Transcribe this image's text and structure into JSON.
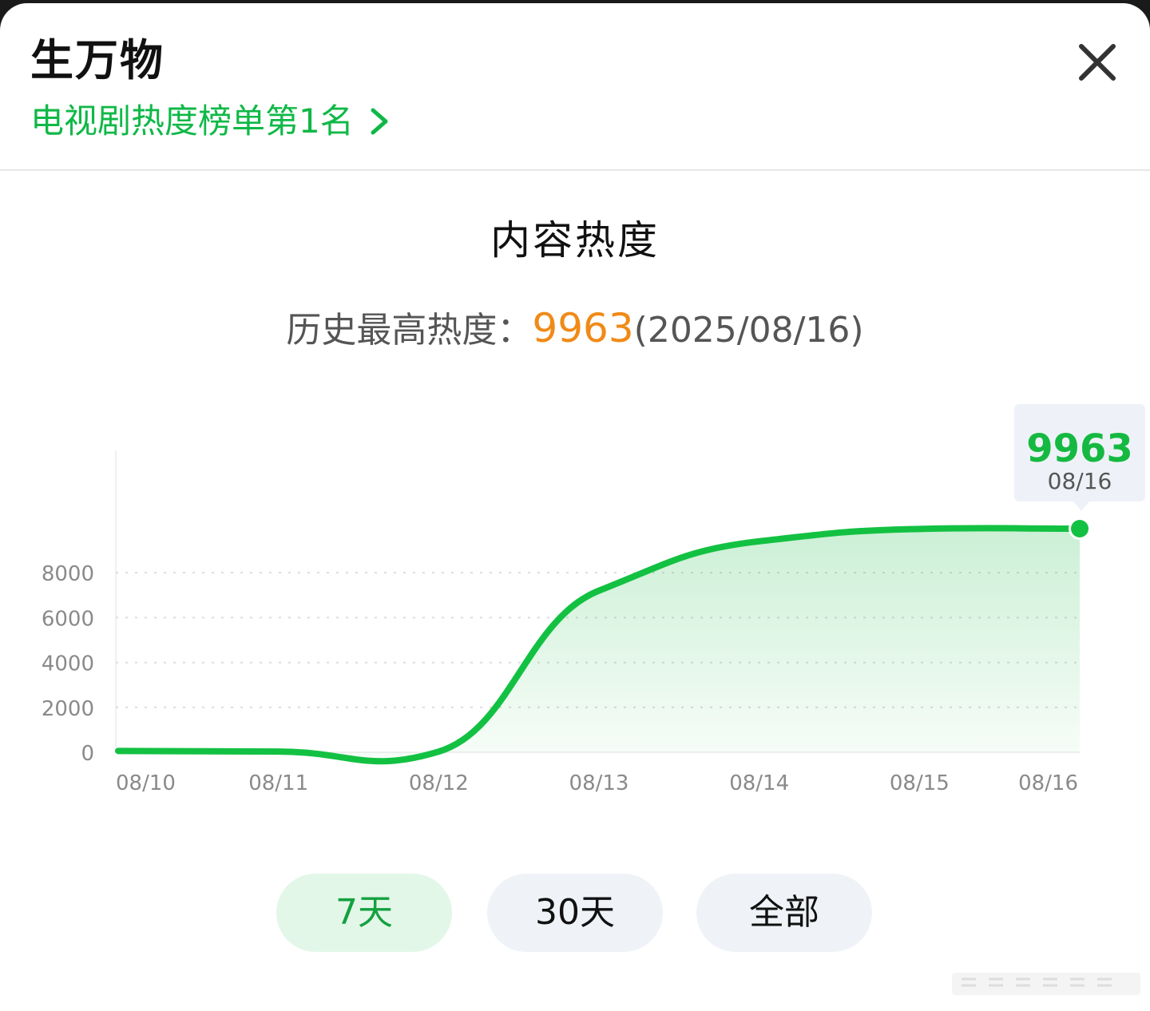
{
  "header": {
    "title": "生万物",
    "rank_link": "电视剧热度榜单第1名"
  },
  "section_title": "内容热度",
  "record": {
    "label": "历史最高热度：",
    "value": "9963",
    "date": "(2025/08/16)"
  },
  "colors": {
    "accent": "#15B941",
    "record_highlight": "#F08A17",
    "active_tab_bg": "#E3F7E8"
  },
  "icons": {
    "close": "close-icon",
    "chevron": "chevron-right-icon"
  },
  "chart_data": {
    "type": "area",
    "title": "",
    "xlabel": "",
    "ylabel": "",
    "categories": [
      "08/10",
      "08/11",
      "08/12",
      "08/13",
      "08/14",
      "08/15",
      "08/16"
    ],
    "series": [
      {
        "values": [
          60,
          30,
          30,
          7200,
          9400,
          9950,
          9963
        ]
      }
    ],
    "y_ticks": [
      0,
      2000,
      4000,
      6000,
      8000
    ],
    "y_tick_labels": [
      "0",
      "2000",
      "4000",
      "6000",
      "8000"
    ],
    "ylim": [
      0,
      10000
    ],
    "grid": true,
    "highlight": {
      "category": "08/16",
      "value": "9963",
      "date_label": "08/16"
    }
  },
  "range_tabs": [
    {
      "label": "7天",
      "selected": true
    },
    {
      "label": "30天",
      "selected": false
    },
    {
      "label": "全部",
      "selected": false
    }
  ]
}
